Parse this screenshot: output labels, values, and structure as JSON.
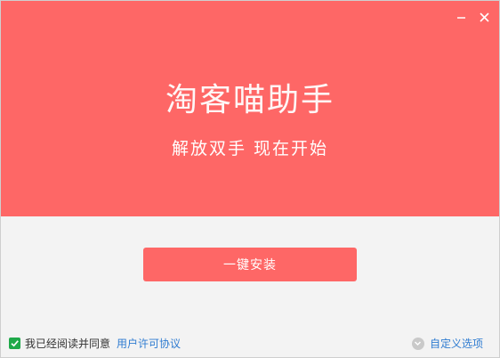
{
  "app": {
    "title": "淘客喵助手",
    "slogan": "解放双手 现在开始"
  },
  "actions": {
    "install_label": "一键安装"
  },
  "footer": {
    "agree_text": "我已经阅读并同意",
    "license_link": "用户许可协议",
    "custom_options": "自定义选项"
  },
  "colors": {
    "brand": "#fe6766",
    "link": "#2f7cd1",
    "check": "#1fa94a"
  },
  "icons": {
    "minimize": "minimize-icon",
    "close": "close-icon",
    "checkbox": "checkmark-icon",
    "options": "chevron-down-circle-icon"
  }
}
